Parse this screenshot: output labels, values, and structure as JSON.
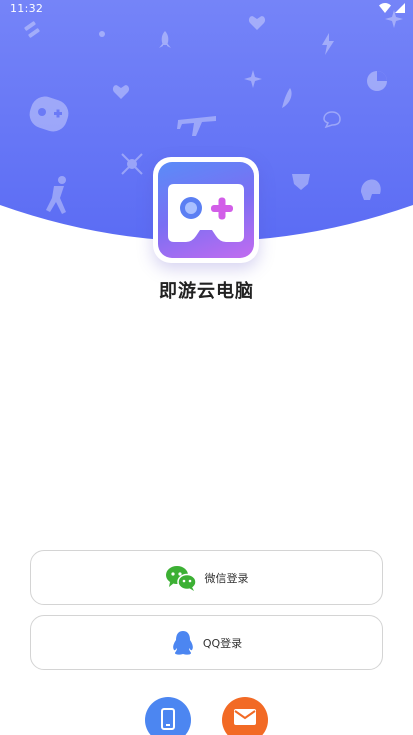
{
  "status_bar": {
    "time": "11:32"
  },
  "app": {
    "name": "即游云电脑"
  },
  "login": {
    "wechat_label": "微信登录",
    "qq_label": "QQ登录"
  },
  "colors": {
    "hero_top": "#6f7df7",
    "hero_bottom": "#5d6ef5",
    "wechat_green": "#3cb034",
    "qq_blue": "#4c86f1",
    "phone_blue": "#4c86f1",
    "email_orange": "#f26a25"
  },
  "icons": {
    "status": [
      "wifi-icon",
      "signal-icon"
    ],
    "hero_decorations": [
      "gamepad-icon",
      "airplane-icon",
      "rocket-icon",
      "heart-icon",
      "lightning-icon",
      "sparkle-icon",
      "basketball-player-icon",
      "chart-icon",
      "helmet-icon"
    ],
    "login": [
      "wechat-icon",
      "qq-icon"
    ],
    "alt_login": [
      "phone-icon",
      "email-icon"
    ]
  }
}
